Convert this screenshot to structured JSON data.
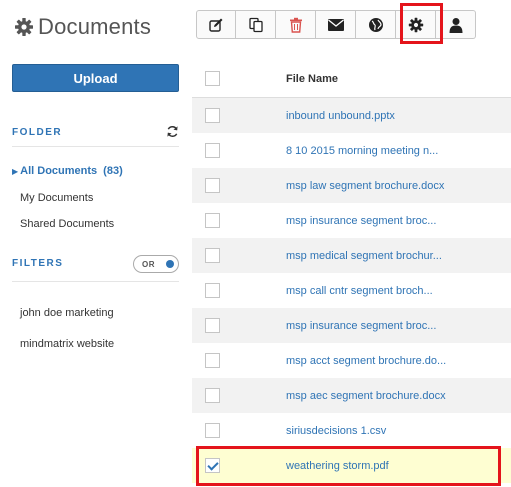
{
  "header": {
    "title": "Documents"
  },
  "toolbar": {
    "buttons": [
      {
        "name": "edit-button",
        "icon": "pencil-square-icon"
      },
      {
        "name": "copy-button",
        "icon": "copy-icon"
      },
      {
        "name": "delete-button",
        "icon": "trash-icon",
        "color": "#d9534f"
      },
      {
        "name": "email-button",
        "icon": "envelope-icon"
      },
      {
        "name": "share-button",
        "icon": "globe-icon"
      },
      {
        "name": "settings-button",
        "icon": "gear-icon",
        "highlighted": true
      },
      {
        "name": "user-button",
        "icon": "user-icon"
      }
    ]
  },
  "sidebar": {
    "upload_label": "Upload",
    "folder_heading": "FOLDER",
    "folders": [
      {
        "label": "All Documents",
        "count": "(83)",
        "active": true
      },
      {
        "label": "My Documents"
      },
      {
        "label": "Shared Documents"
      }
    ],
    "filters_heading": "FILTERS",
    "toggle_label": "OR",
    "filters": [
      {
        "label": "john doe marketing"
      },
      {
        "label": "mindmatrix website"
      }
    ]
  },
  "table": {
    "header": "File Name",
    "rows": [
      {
        "name": "inbound unbound.pptx",
        "checked": false
      },
      {
        "name": "8 10 2015 morning meeting n...",
        "checked": false
      },
      {
        "name": "msp law segment brochure.docx",
        "checked": false
      },
      {
        "name": "msp insurance segment broc...",
        "checked": false
      },
      {
        "name": "msp medical segment brochur...",
        "checked": false
      },
      {
        "name": "msp call cntr segment broch...",
        "checked": false
      },
      {
        "name": "msp insurance segment broc...",
        "checked": false
      },
      {
        "name": "msp acct segment brochure.do...",
        "checked": false
      },
      {
        "name": "msp aec segment brochure.docx",
        "checked": false
      },
      {
        "name": "siriusdecisions 1.csv",
        "checked": false
      },
      {
        "name": "weathering storm.pdf",
        "checked": true,
        "selected": true
      }
    ]
  },
  "colors": {
    "accent": "#2f74b5",
    "highlight": "#e4141b",
    "selected_row": "#fefed2"
  }
}
